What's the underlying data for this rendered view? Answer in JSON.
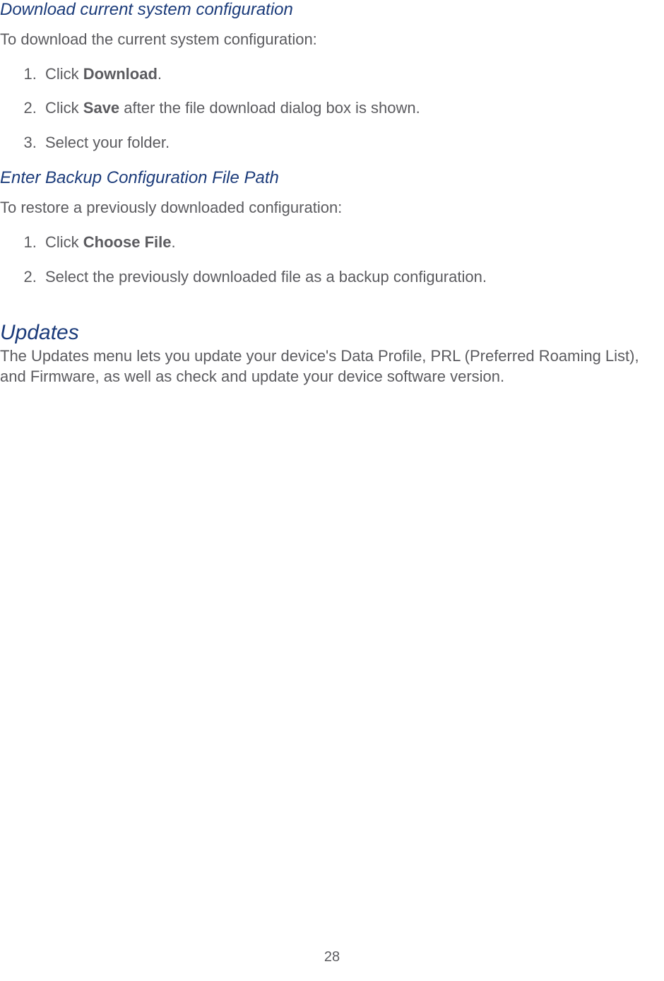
{
  "section1": {
    "title": "Download current system configuration",
    "intro": "To download the current system configuration:",
    "steps": [
      {
        "pre": "Click ",
        "bold": "Download",
        "post": "."
      },
      {
        "pre": "Click ",
        "bold": "Save",
        "post": " after the file download dialog box is shown."
      },
      {
        "pre": "Select your folder.",
        "bold": "",
        "post": ""
      }
    ]
  },
  "section2": {
    "title": "Enter Backup Configuration File Path",
    "intro": "To restore a previously downloaded configuration:",
    "steps": [
      {
        "pre": "Click ",
        "bold": "Choose File",
        "post": "."
      },
      {
        "pre": "Select the previously downloaded file as a backup configuration.",
        "bold": "",
        "post": ""
      }
    ]
  },
  "section3": {
    "title": "Updates",
    "body": "The Updates menu lets you update your device's Data Profile, PRL (Preferred Roaming List), and Firmware, as well as check and update your device software version."
  },
  "pageNumber": "28"
}
